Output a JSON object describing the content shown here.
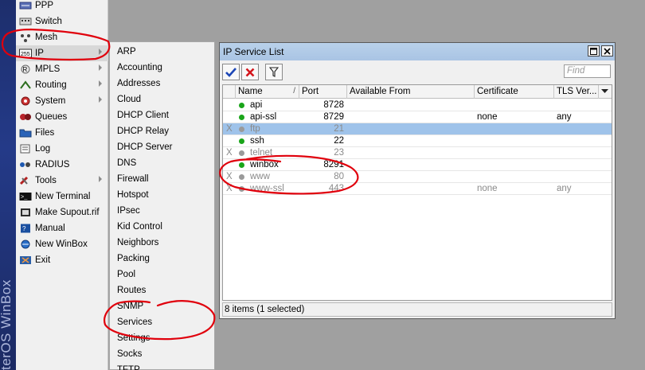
{
  "brand": {
    "vertical_text": "terOS WinBox"
  },
  "main_menu": [
    {
      "label": "PPP",
      "icon": "ppp-icon",
      "arrow": false
    },
    {
      "label": "Switch",
      "icon": "switch-icon",
      "arrow": false
    },
    {
      "label": "Mesh",
      "icon": "mesh-icon",
      "arrow": false
    },
    {
      "label": "IP",
      "icon": "ip-icon",
      "arrow": true,
      "active": true
    },
    {
      "label": "MPLS",
      "icon": "mpls-icon",
      "arrow": true
    },
    {
      "label": "Routing",
      "icon": "routing-icon",
      "arrow": true
    },
    {
      "label": "System",
      "icon": "system-icon",
      "arrow": true
    },
    {
      "label": "Queues",
      "icon": "queues-icon",
      "arrow": false
    },
    {
      "label": "Files",
      "icon": "files-icon",
      "arrow": false
    },
    {
      "label": "Log",
      "icon": "log-icon",
      "arrow": false
    },
    {
      "label": "RADIUS",
      "icon": "radius-icon",
      "arrow": false
    },
    {
      "label": "Tools",
      "icon": "tools-icon",
      "arrow": true
    },
    {
      "label": "New Terminal",
      "icon": "terminal-icon",
      "arrow": false
    },
    {
      "label": "Make Supout.rif",
      "icon": "supout-icon",
      "arrow": false
    },
    {
      "label": "Manual",
      "icon": "manual-icon",
      "arrow": false
    },
    {
      "label": "New WinBox",
      "icon": "winbox-icon",
      "arrow": false
    },
    {
      "label": "Exit",
      "icon": "exit-icon",
      "arrow": false
    }
  ],
  "ip_submenu": [
    "ARP",
    "Accounting",
    "Addresses",
    "Cloud",
    "DHCP Client",
    "DHCP Relay",
    "DHCP Server",
    "DNS",
    "Firewall",
    "Hotspot",
    "IPsec",
    "Kid Control",
    "Neighbors",
    "Packing",
    "Pool",
    "Routes",
    "SNMP",
    "Services",
    "Settings",
    "Socks",
    "TFTP"
  ],
  "window": {
    "title": "IP Service List",
    "find_placeholder": "Find",
    "columns": [
      "Name",
      "Port",
      "Available From",
      "Certificate",
      "TLS Ver..."
    ],
    "rows": [
      {
        "flag": "",
        "name": "api",
        "port": "8728",
        "available_from": "",
        "certificate": "",
        "tls": "",
        "status": "enabled",
        "selected": false
      },
      {
        "flag": "",
        "name": "api-ssl",
        "port": "8729",
        "available_from": "",
        "certificate": "none",
        "tls": "any",
        "status": "enabled",
        "selected": false
      },
      {
        "flag": "X",
        "name": "ftp",
        "port": "21",
        "available_from": "",
        "certificate": "",
        "tls": "",
        "status": "disabled",
        "selected": true
      },
      {
        "flag": "",
        "name": "ssh",
        "port": "22",
        "available_from": "",
        "certificate": "",
        "tls": "",
        "status": "enabled",
        "selected": false
      },
      {
        "flag": "X",
        "name": "telnet",
        "port": "23",
        "available_from": "",
        "certificate": "",
        "tls": "",
        "status": "disabled",
        "selected": false
      },
      {
        "flag": "",
        "name": "winbox",
        "port": "8291",
        "available_from": "",
        "certificate": "",
        "tls": "",
        "status": "enabled",
        "selected": false
      },
      {
        "flag": "X",
        "name": "www",
        "port": "80",
        "available_from": "",
        "certificate": "",
        "tls": "",
        "status": "disabled",
        "selected": false
      },
      {
        "flag": "X",
        "name": "www-ssl",
        "port": "443",
        "available_from": "",
        "certificate": "none",
        "tls": "any",
        "status": "disabled",
        "selected": false
      }
    ],
    "status": "8 items (1 selected)"
  },
  "colors": {
    "enabled_dot": "#1aa51a",
    "disabled_dot": "#9a9a9a",
    "selection": "#9fc3ea",
    "annotation": "#e0000c"
  }
}
